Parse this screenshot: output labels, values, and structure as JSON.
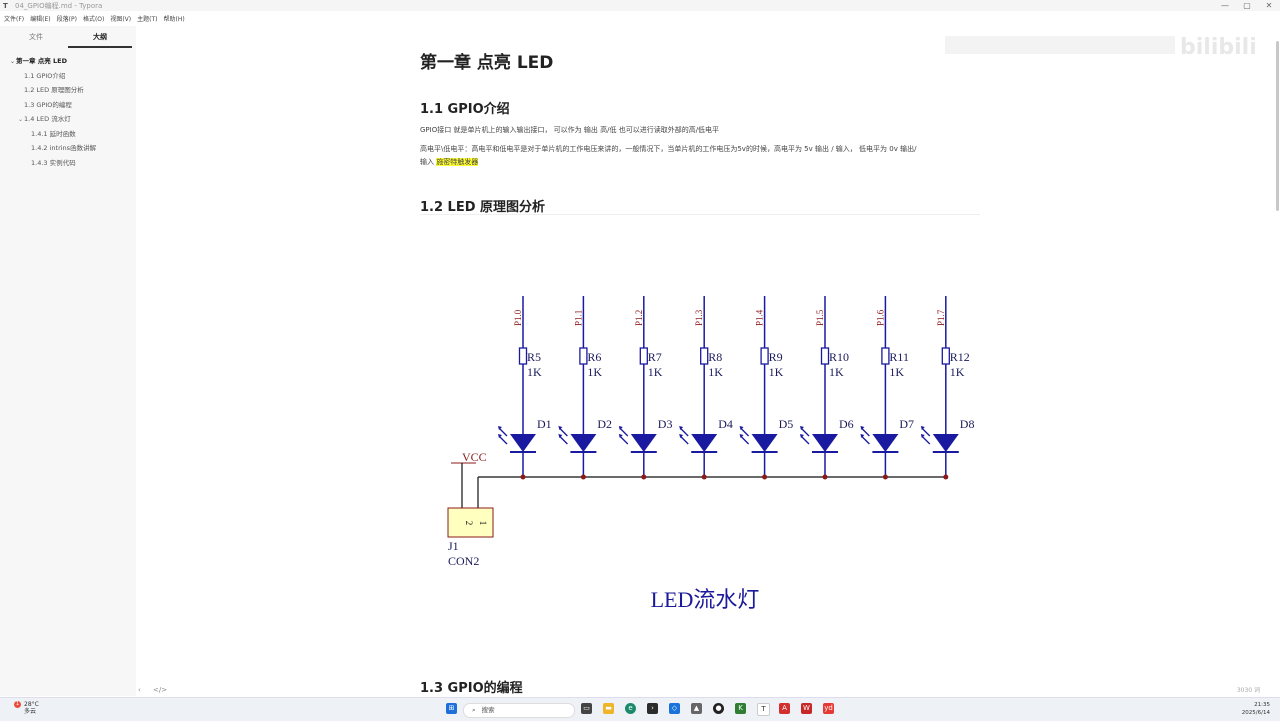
{
  "window": {
    "app_icon": "T",
    "title": "04_GPIO编程.md - Typora",
    "controls": [
      "—",
      "▢",
      "✕"
    ]
  },
  "menu": [
    "文件(F)",
    "编辑(E)",
    "段落(P)",
    "格式(O)",
    "视图(V)",
    "主题(T)",
    "帮助(H)"
  ],
  "sidebar": {
    "tabs": [
      "文件",
      "大纲"
    ],
    "outline": [
      {
        "label": "第一章 点亮 LED",
        "caret": "⌄"
      },
      {
        "label": "1.1 GPIO介绍"
      },
      {
        "label": "1.2 LED 原理图分析"
      },
      {
        "label": "1.3 GPIO的编程"
      },
      {
        "label": "1.4 LED 流水灯",
        "caret": "⌄"
      },
      {
        "label": "1.4.1 延时函数"
      },
      {
        "label": "1.4.2 intrins函数讲解"
      },
      {
        "label": "1.4.3 实例代码"
      }
    ],
    "footer_back": "‹",
    "footer_code": "</>"
  },
  "document": {
    "h1": "第一章 点亮 LED",
    "h2_1": "1.1 GPIO介绍",
    "p1": "GPIO接口 就是单片机上的输入输出接口， 可以作为 输出 高/低 也可以进行读取外部的高/低电平",
    "p2": "高电平\\低电平：高电平和低电平是对于单片机的工作电压来讲的，一般情况下，当单片机的工作电压为5v的时候，高电平为 5v 输出 / 输入， 低电平为 0v 输出/",
    "p3_prefix": "输入",
    "p3_highlight": "施密特触发器",
    "h2_2": "1.2 LED 原理图分析",
    "h2_3": "1.3 GPIO的编程",
    "word_count": "3030 词"
  },
  "schematic": {
    "pins": [
      "P1.0",
      "P1.1",
      "P1.2",
      "P1.3",
      "P1.4",
      "P1.5",
      "P1.6",
      "P1.7"
    ],
    "resistors": [
      "R5",
      "R6",
      "R7",
      "R8",
      "R9",
      "R10",
      "R11",
      "R12"
    ],
    "resistor_value": "1K",
    "leds": [
      "D1",
      "D2",
      "D3",
      "D4",
      "D5",
      "D6",
      "D7",
      "D8"
    ],
    "vcc": "VCC",
    "connector_ref": "J1",
    "connector_name": "CON2",
    "connector_pins": [
      "2",
      "1"
    ],
    "caption": "LED流水灯",
    "wire_color": "#1a1aa0",
    "label_color": "#8b1a1a"
  },
  "watermark": "bilibili",
  "taskbar": {
    "weather_temp": "28°C",
    "weather_desc": "多云",
    "weather_badge": "1",
    "search_placeholder": "搜索",
    "time": "21:35",
    "date": "2025/6/14"
  }
}
